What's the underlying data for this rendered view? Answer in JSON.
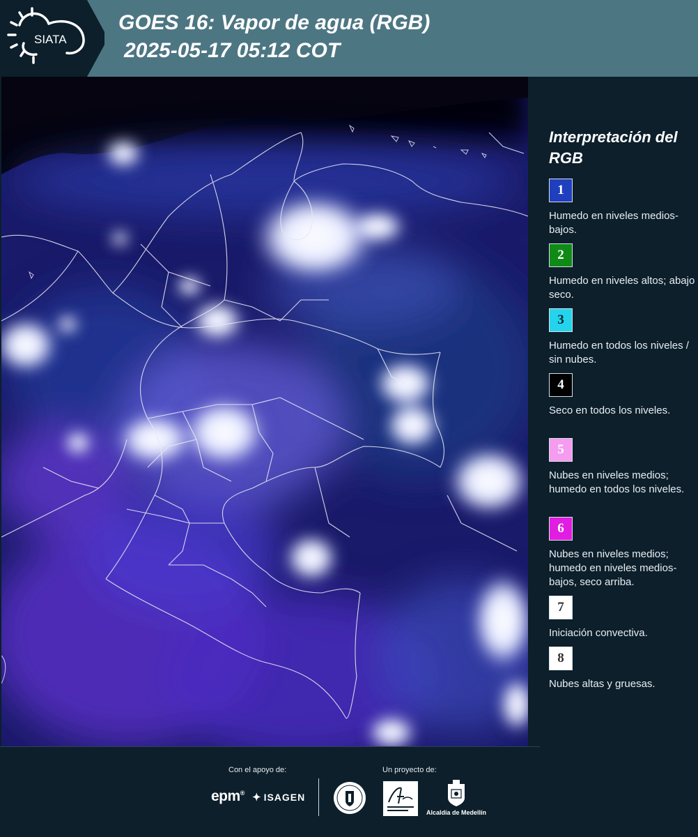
{
  "header": {
    "logo_text": "SIATA",
    "title_line1": "GOES 16: Vapor de agua (RGB)",
    "title_line2": "2025-05-17 05:12 COT"
  },
  "legend": {
    "title": "Interpretación del RGB",
    "items": [
      {
        "number": "1",
        "color": "#1f3fbf",
        "number_color": "#ffffff",
        "text": "Humedo en niveles medios-bajos."
      },
      {
        "number": "2",
        "color": "#0f8a16",
        "number_color": "#ffffff",
        "text": "Humedo en niveles altos; abajo seco."
      },
      {
        "number": "3",
        "color": "#24d4ec",
        "number_color": "#0c1f2b",
        "text": "Humedo en todos los niveles / sin nubes."
      },
      {
        "number": "4",
        "color": "#000000",
        "number_color": "#ffffff",
        "text": "Seco en todos los niveles."
      },
      {
        "number": "5",
        "color": "#f59bf0",
        "number_color": "#ffffff",
        "text": "Nubes en niveles medios; humedo en todos los niveles."
      },
      {
        "number": "6",
        "color": "#e01de0",
        "number_color": "#ffffff",
        "text": "Nubes en niveles medios; humedo en niveles medios-bajos, seco arriba."
      },
      {
        "number": "7",
        "color": "#ffffff",
        "number_color": "#333333",
        "text": "Iniciación convectiva."
      },
      {
        "number": "8",
        "color": "#ffffff",
        "number_color": "#333333",
        "text": "Nubes altas y gruesas."
      }
    ]
  },
  "footer": {
    "support_label": "Con el apoyo de:",
    "project_label": "Un proyecto de:",
    "epm_text": "epm",
    "epm_reg": "®",
    "isagen_text": "ISAGEN",
    "alcaldia_text": "Alcaldía de Medellín"
  },
  "colors": {
    "header_bg": "#4d7683",
    "logo_bg": "#0c1f2b",
    "page_bg": "#0c1f2b",
    "map_base": "#0b0a2e"
  }
}
